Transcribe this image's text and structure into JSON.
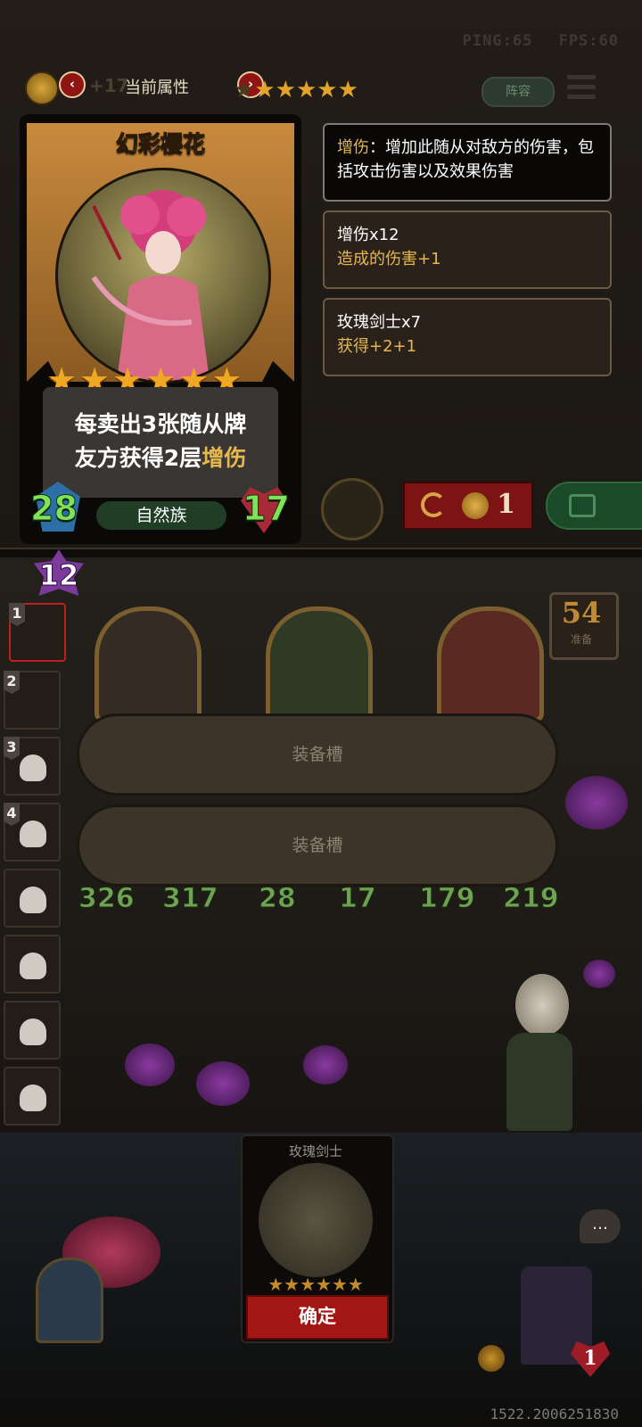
{
  "hud": {
    "ping": "PING:65",
    "fps": "FPS:60"
  },
  "topbar": {
    "gold_plus": "+17",
    "attributes_label": "当前属性",
    "stars": 6,
    "lineup_label": "阵容",
    "prev_icon": "chevron-left-icon",
    "next_icon": "chevron-right-icon"
  },
  "card": {
    "name": "幻彩樱花",
    "stars": 6,
    "desc_line1": "每卖出3张随从牌",
    "desc_line2_prefix": "友方获得2层",
    "desc_keyword": "增伤",
    "attack": "28",
    "health": "17",
    "tribe": "自然族"
  },
  "panels": [
    {
      "keyword": "增伤",
      "text": "：增加此随从对敌方的伤害，包括攻击伤害以及效果伤害"
    },
    {
      "title": "增伤x12",
      "sub": "造成的伤害+1"
    },
    {
      "title": "玫瑰剑士x7",
      "sub": "获得+2+1"
    }
  ],
  "actions": {
    "refresh_cost": "1"
  },
  "board": {
    "level": "12",
    "ready_count": "54",
    "ready_label": "准备",
    "player_slots": [
      "1",
      "2",
      "3",
      "4"
    ],
    "equip_slots": [
      "装备槽",
      "装备槽"
    ],
    "minions": [
      {
        "atk": "326",
        "hp": "317"
      },
      {
        "atk": "28",
        "hp": "17"
      },
      {
        "atk": "179",
        "hp": "219"
      }
    ]
  },
  "shop": {
    "card_name": "玫瑰剑士",
    "stars": 6,
    "confirm_label": "确定"
  },
  "footer": {
    "lives": "1",
    "coord": "1522.2006251830"
  },
  "colors": {
    "accent_gold": "#e6b74d",
    "stat_green": "#7fe35a",
    "button_red": "#a21714"
  }
}
